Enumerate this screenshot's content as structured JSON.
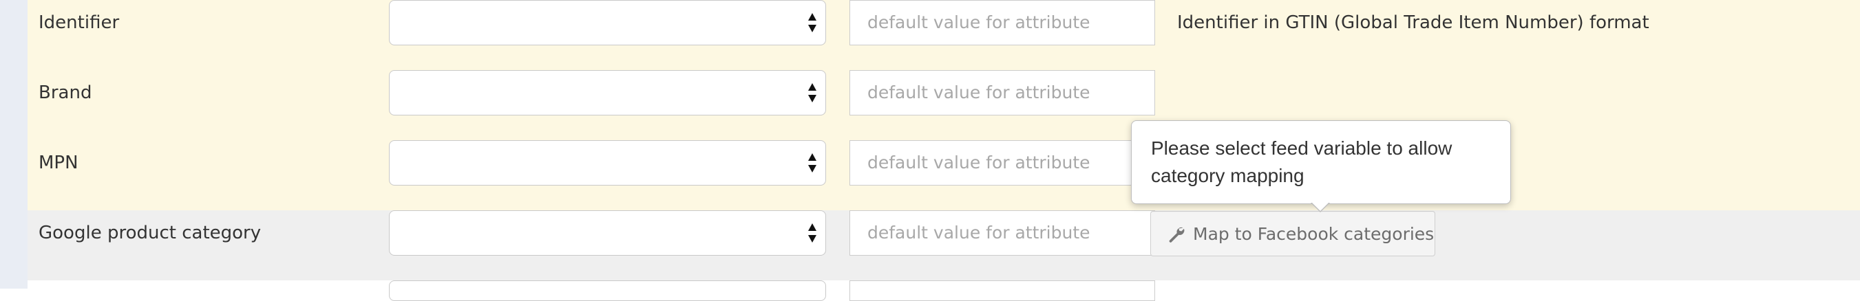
{
  "rows": [
    {
      "label": "Identifier",
      "select_value": "",
      "input_placeholder": "default value for attribute",
      "description": "Identifier in GTIN (Global Trade Item Number) format"
    },
    {
      "label": "Brand",
      "select_value": "",
      "input_placeholder": "default value for attribute",
      "description": ""
    },
    {
      "label": "MPN",
      "select_value": "",
      "input_placeholder": "default value for attribute",
      "description": ""
    },
    {
      "label": "Google product category",
      "select_value": "",
      "input_placeholder": "default value for attribute",
      "button_label": "Map to Facebook categories",
      "button_icon": "wrench-icon"
    }
  ],
  "tooltip": {
    "text": "Please select feed variable to allow category mapping"
  },
  "colors": {
    "highlight_row": "#fdf8e2",
    "grey_row": "#efefef",
    "left_strip": "#e9edf4"
  }
}
